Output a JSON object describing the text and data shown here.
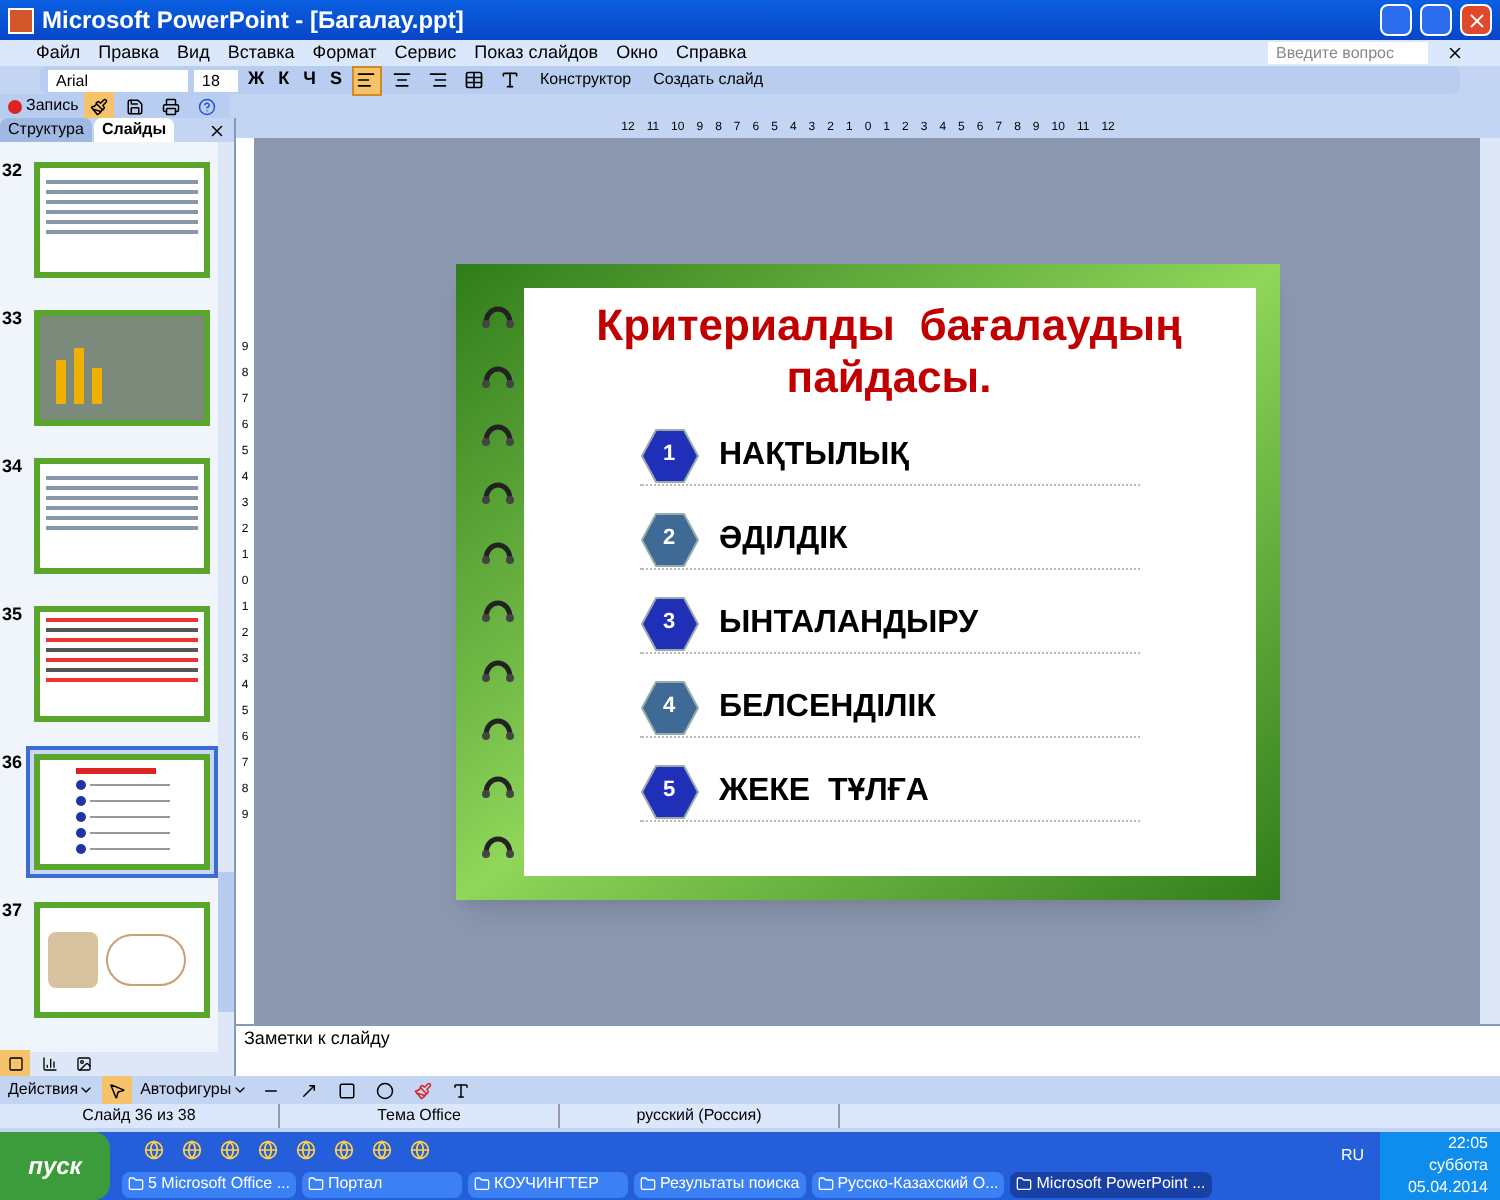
{
  "window": {
    "title": "Microsoft PowerPoint - [Багалау.ppt]"
  },
  "menu": [
    "Файл",
    "Правка",
    "Вид",
    "Вставка",
    "Формат",
    "Сервис",
    "Показ слайдов",
    "Окно",
    "Справка"
  ],
  "help_search": {
    "placeholder": "Введите вопрос"
  },
  "formatting": {
    "font": "Arial",
    "size": "18",
    "styles": [
      "Ж",
      "К",
      "Ч",
      "S"
    ],
    "designer": "Конструктор",
    "new_slide": "Создать слайд"
  },
  "record": {
    "label": "Запись"
  },
  "pane_tabs": [
    {
      "label": "Структура",
      "selected": false
    },
    {
      "label": "Слайды",
      "selected": true
    }
  ],
  "slides": [
    {
      "number": "32",
      "kind": "table",
      "selected": false
    },
    {
      "number": "33",
      "kind": "chart",
      "selected": false
    },
    {
      "number": "34",
      "kind": "table",
      "selected": false
    },
    {
      "number": "35",
      "kind": "text",
      "selected": false
    },
    {
      "number": "36",
      "kind": "list",
      "selected": true
    },
    {
      "number": "37",
      "kind": "picture",
      "selected": false
    }
  ],
  "ruler": {
    "horizontal": [
      "12",
      "11",
      "10",
      "9",
      "8",
      "7",
      "6",
      "5",
      "4",
      "3",
      "2",
      "1",
      "0",
      "1",
      "2",
      "3",
      "4",
      "5",
      "6",
      "7",
      "8",
      "9",
      "10",
      "11",
      "12"
    ],
    "vertical": [
      "9",
      "8",
      "7",
      "6",
      "5",
      "4",
      "3",
      "2",
      "1",
      "0",
      "1",
      "2",
      "3",
      "4",
      "5",
      "6",
      "7",
      "8",
      "9"
    ]
  },
  "slide": {
    "title": "Критериалды  бағалаудың пайдасы.",
    "items": [
      {
        "number": "1",
        "text": "НАҚТЫЛЫҚ",
        "color": "#1f2fb8"
      },
      {
        "number": "2",
        "text": "ӘДІЛДІК",
        "color": "#3f6a96"
      },
      {
        "number": "3",
        "text": "ЫНТАЛАНДЫРУ",
        "color": "#1f2fb8"
      },
      {
        "number": "4",
        "text": "БЕЛСЕНДІЛІК",
        "color": "#3f6a96"
      },
      {
        "number": "5",
        "text": "ЖЕКЕ  ТҰЛҒА",
        "color": "#1f2fb8"
      }
    ]
  },
  "notes": "Заметки к слайду",
  "drawing": {
    "actions": "Действия",
    "autoshapes": "Автофигуры"
  },
  "status_bar": [
    "Слайд 36 из 38",
    "Тема Office",
    "русский (Россия)"
  ],
  "taskbar": {
    "start": "пуск",
    "tasks": [
      {
        "label": "5 Microsoft Office ...",
        "selected": false
      },
      {
        "label": "Портал",
        "selected": false
      },
      {
        "label": "КОУЧИНГТЕР",
        "selected": false
      },
      {
        "label": "Результаты поиска",
        "selected": false
      },
      {
        "label": "Русско-Казахский О...",
        "selected": false
      },
      {
        "label": "Microsoft PowerPoint ...",
        "selected": true
      }
    ],
    "language": "RU",
    "time": "22:05",
    "day": "суббота",
    "date": "05.04.2014"
  }
}
